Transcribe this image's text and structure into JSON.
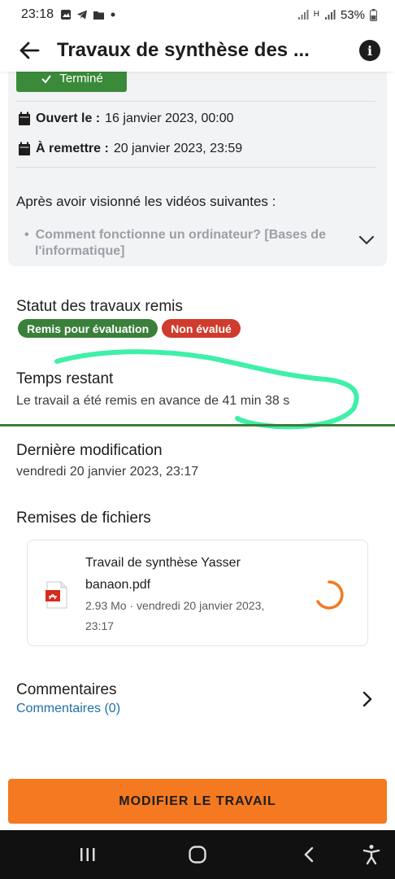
{
  "status_bar": {
    "time": "23:18",
    "battery": "53%",
    "network": "H"
  },
  "app_bar": {
    "title": "Travaux de synthèse des ..."
  },
  "info_card": {
    "termine_label": "Terminé",
    "opened_label": "Ouvert le :",
    "opened_value": "16 janvier 2023, 00:00",
    "due_label": "À remettre :",
    "due_value": "20 janvier 2023, 23:59",
    "intro": "Après avoir visionné les vidéos suivantes :",
    "bullet_line1": "Comment fonctionne un ordinateur? [Bases de",
    "bullet_line2": "l'informatique]"
  },
  "submission_status": {
    "title": "Statut des travaux remis",
    "badges": [
      {
        "label": "Remis pour évaluation",
        "color": "#3a7f3a"
      },
      {
        "label": "Non évalué",
        "color": "#cf3b2c"
      }
    ]
  },
  "time_remaining": {
    "title": "Temps restant",
    "value": "Le travail a été remis en avance de 41 min 38 s"
  },
  "last_modified": {
    "title": "Dernière modification",
    "value": "vendredi 20 janvier 2023, 23:17"
  },
  "file_submissions": {
    "title": "Remises de fichiers",
    "file": {
      "name_line1": "Travail de synthèse Yasser",
      "name_line2": "banaon.pdf",
      "meta_line1": "2.93 Mo · vendredi 20 janvier 2023,",
      "meta_line2": "23:17"
    }
  },
  "comments": {
    "title": "Commentaires",
    "link": "Commentaires (0)"
  },
  "actions": {
    "modify_label": "MODIFIER LE TRAVAIL"
  },
  "colors": {
    "accent_orange": "#f47920",
    "status_green": "#3a7f3a",
    "status_red": "#cf3b2c",
    "link_blue": "#1f6fa8",
    "highlight_scribble": "#3ef0a8"
  }
}
